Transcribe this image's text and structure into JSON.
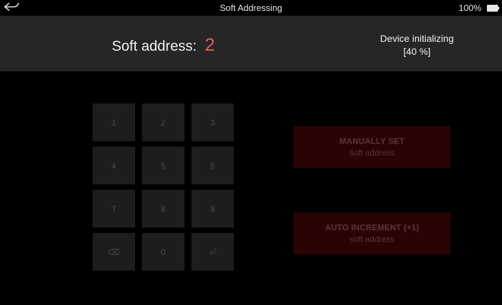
{
  "status_bar": {
    "title": "Soft Addressing",
    "battery_percent": "100%",
    "back_icon": "back-arrow-icon",
    "battery_icon": "battery-icon"
  },
  "header": {
    "soft_address_label": "Soft address:",
    "soft_address_value": "2",
    "device_status_line1": "Device initializing",
    "device_status_line2": "[40 %]"
  },
  "keypad": {
    "keys": [
      "1",
      "2",
      "3",
      "4",
      "5",
      "6",
      "7",
      "8",
      "9",
      "⌫",
      "0",
      "⏎"
    ]
  },
  "actions": {
    "manual": {
      "main": "MANUALLY SET",
      "sub": "soft address"
    },
    "auto": {
      "main": "AUTO INCREMENT (+1)",
      "sub": "soft address"
    }
  },
  "colors": {
    "accent_value": "#ef5b5b",
    "header_bg": "#262626",
    "action_bg": "#2a0404",
    "key_bg": "#1d1d1d"
  }
}
